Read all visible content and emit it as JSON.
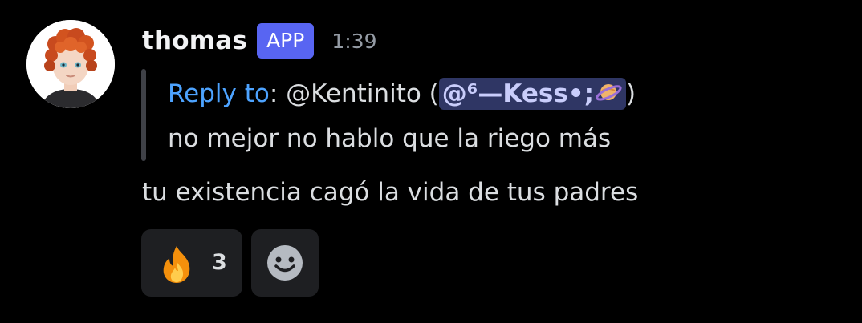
{
  "message": {
    "author": {
      "username": "thomas",
      "tag": "APP",
      "avatar_icon": "avatar-icon"
    },
    "timestamp": "1:39",
    "reply": {
      "prefix": "Reply to",
      "separator": ": ",
      "author": "@Kentinito",
      "open_paren": " (",
      "mention": "@⁶—Kess•;",
      "mention_emoji": "ringed-planet-icon",
      "close_paren": ")",
      "text": "no mejor no hablo que la riego más"
    },
    "content": "tu existencia cagó la vida de tus padres",
    "reactions": [
      {
        "emoji": "fire-icon",
        "count": "3"
      }
    ],
    "add_reaction_icon": "smiley-icon"
  },
  "colors": {
    "background": "#000000",
    "app_tag": "#5865f2",
    "reply_link": "#4da3ff",
    "mention_bg": "#2f3664",
    "reaction_bg": "#1e1f22"
  }
}
